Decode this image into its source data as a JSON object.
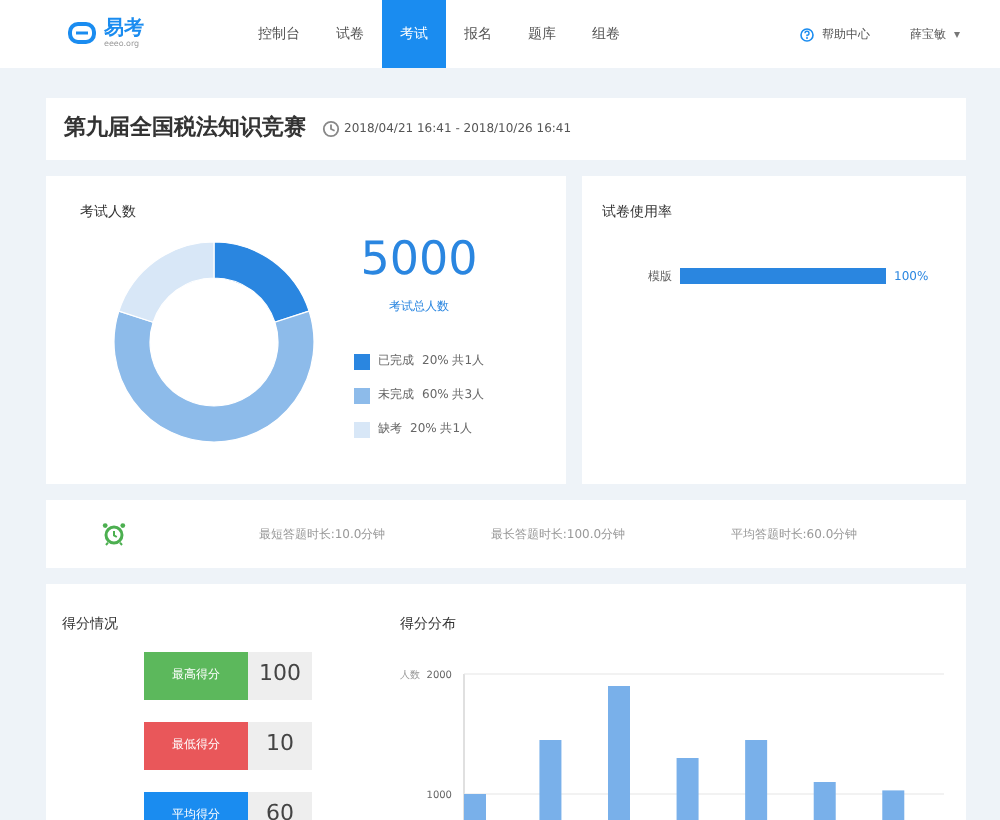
{
  "header": {
    "logo": {
      "name": "易考",
      "sub": "eeeo.org"
    },
    "nav": [
      {
        "label": "控制台",
        "selected": false
      },
      {
        "label": "试卷",
        "selected": false
      },
      {
        "label": "考试",
        "selected": true
      },
      {
        "label": "报名",
        "selected": false
      },
      {
        "label": "题库",
        "selected": false
      },
      {
        "label": "组卷",
        "selected": false
      }
    ],
    "help": "帮助中心",
    "user": "薛宝敏",
    "user_caret": "▾"
  },
  "exam": {
    "title": "第九届全国税法知识竞赛",
    "period": "2018/04/21 16:41 - 2018/10/26 16:41"
  },
  "participants": {
    "total": "5000",
    "total_label": "考试总人数",
    "chart_data": {
      "type": "donut",
      "categories": [
        "已完成",
        "未完成",
        "缺考"
      ],
      "series": [
        {
          "name": "考试人数",
          "values": [
            20,
            60,
            20
          ]
        }
      ]
    },
    "legend": [
      {
        "detail": "20% 共1人",
        "color": "#2a86e0"
      },
      {
        "detail": "60% 共3人",
        "color": "#8dbbea"
      },
      {
        "detail": "20% 共1人",
        "color": "#d8e7f7"
      }
    ]
  },
  "usage": {
    "title": "试卷使用率",
    "rows": [
      {
        "label": "模版",
        "level": 1,
        "reading": "100%"
      }
    ]
  },
  "durations": [
    "最短答题时长:10.0分钟",
    "最长答题时长:100.0分钟",
    "平均答题时长:60.0分钟"
  ],
  "scores": {
    "title": "得分情况",
    "items": [
      {
        "label": "最高得分",
        "value": "100",
        "color": "#5cb85c"
      },
      {
        "label": "最低得分",
        "value": "10",
        "color": "#e9575a"
      },
      {
        "label": "平均得分",
        "value": "60",
        "color": "#1a8cf0"
      }
    ]
  },
  "distribution": {
    "title": "得分分布",
    "chart_data": {
      "type": "bar",
      "ylabel": "人数",
      "yticks": [
        1000,
        2000
      ],
      "ylim": [
        0,
        2000
      ],
      "values": [
        1000,
        1450,
        1900,
        1300,
        1450,
        1100,
        1030
      ]
    }
  }
}
